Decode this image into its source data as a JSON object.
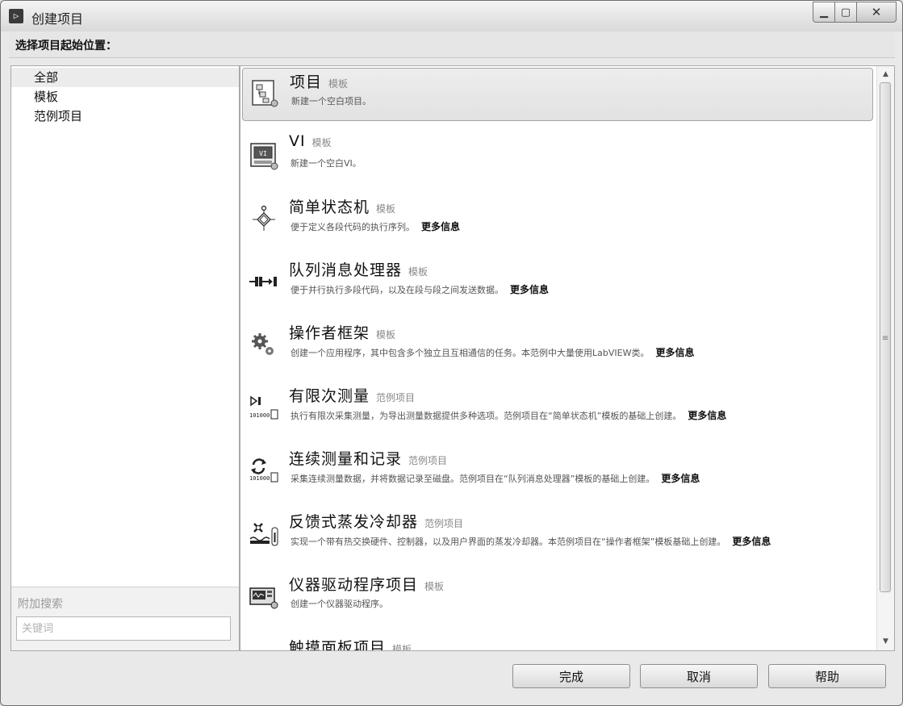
{
  "window": {
    "title": "创建项目"
  },
  "header": {
    "label": "选择项目起始位置："
  },
  "categories": [
    {
      "label": "全部",
      "selected": true
    },
    {
      "label": "模板",
      "selected": false
    },
    {
      "label": "范例项目",
      "selected": false
    }
  ],
  "search": {
    "label": "附加搜索",
    "placeholder": "关键词"
  },
  "items": [
    {
      "title": "项目",
      "tag": "模板",
      "desc": "新建一个空白项目。",
      "more": "",
      "icon": "project-icon"
    },
    {
      "title": "VI",
      "tag": "模板",
      "desc": "新建一个空白VI。",
      "more": "",
      "icon": "vi-icon"
    },
    {
      "title": "简单状态机",
      "tag": "模板",
      "desc": "便于定义各段代码的执行序列。",
      "more": "更多信息",
      "icon": "state-machine-icon"
    },
    {
      "title": "队列消息处理器",
      "tag": "模板",
      "desc": "便于并行执行多段代码，以及在段与段之间发送数据。",
      "more": "更多信息",
      "icon": "queue-icon"
    },
    {
      "title": "操作者框架",
      "tag": "模板",
      "desc": "创建一个应用程序，其中包含多个独立且互相通信的任务。本范例中大量使用LabVIEW类。",
      "more": "更多信息",
      "icon": "gears-icon"
    },
    {
      "title": "有限次测量",
      "tag": "范例项目",
      "desc": "执行有限次采集测量，为导出测量数据提供多种选项。范例项目在“简单状态机”模板的基础上创建。",
      "more": "更多信息",
      "icon": "finite-measure-icon"
    },
    {
      "title": "连续测量和记录",
      "tag": "范例项目",
      "desc": "采集连续测量数据，并将数据记录至磁盘。范例项目在“队列消息处理器”模板的基础上创建。",
      "more": "更多信息",
      "icon": "continuous-measure-icon"
    },
    {
      "title": "反馈式蒸发冷却器",
      "tag": "范例项目",
      "desc": "实现一个带有热交换硬件、控制器，以及用户界面的蒸发冷却器。本范例项目在“操作者框架”模板基础上创建。",
      "more": "更多信息",
      "icon": "cooler-icon"
    },
    {
      "title": "仪器驱动程序项目",
      "tag": "模板",
      "desc": "创建一个仪器驱动程序。",
      "more": "",
      "icon": "instrument-icon"
    },
    {
      "title": "触摸面板项目",
      "tag": "模板",
      "desc": "",
      "more": "",
      "icon": "touch-panel-icon"
    }
  ],
  "buttons": {
    "finish": "完成",
    "cancel": "取消",
    "help": "帮助"
  }
}
